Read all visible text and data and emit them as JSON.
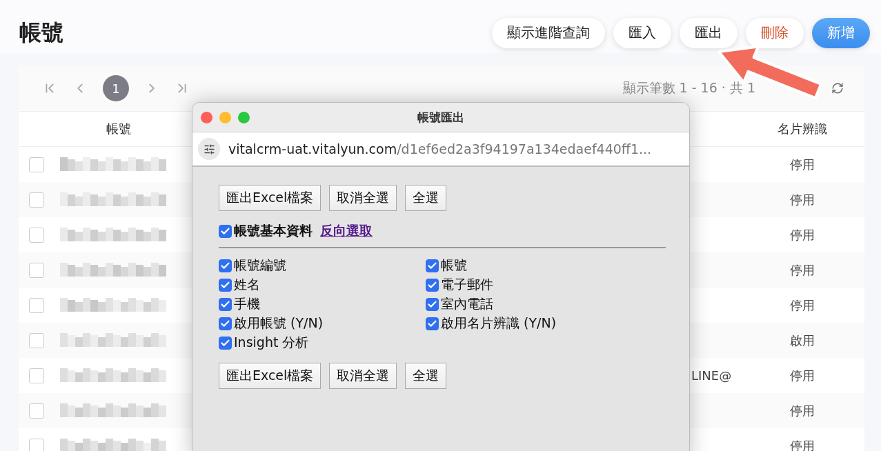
{
  "page": {
    "title": "帳號"
  },
  "actions": [
    {
      "label": "顯示進階查詢",
      "kind": "default"
    },
    {
      "label": "匯入",
      "kind": "default"
    },
    {
      "label": "匯出",
      "kind": "default"
    },
    {
      "label": "刪除",
      "kind": "danger"
    },
    {
      "label": "新增",
      "kind": "primary"
    }
  ],
  "pagination": {
    "pages": [
      {
        "label": "1",
        "selected": true
      }
    ],
    "summary": "顯示筆數 1 - 16 · 共 1"
  },
  "table": {
    "columns": [
      "帳號",
      "名片辨識"
    ],
    "rows": [
      {
        "checked": false,
        "card_recognition": "停用"
      },
      {
        "checked": false,
        "card_recognition": "停用"
      },
      {
        "checked": false,
        "card_recognition": "停用"
      },
      {
        "checked": false,
        "card_recognition": "停用"
      },
      {
        "checked": false,
        "card_recognition": "停用"
      },
      {
        "checked": false,
        "card_recognition": "啟用"
      },
      {
        "checked": false,
        "column_3": "LINE@",
        "card_recognition": "停用"
      },
      {
        "checked": false,
        "card_recognition": "停用"
      },
      {
        "checked": false,
        "card_recognition": "停用"
      }
    ]
  },
  "dialog": {
    "title": "帳號匯出",
    "url_host": "vitalcrm-uat.vitalyun.com",
    "url_path": "/d1ef6ed2a3f94197a134edaef440ff1...",
    "buttons_top": [
      "匯出Excel檔案",
      "取消全選",
      "全選"
    ],
    "group": {
      "label": "帳號基本資料",
      "checked": true,
      "link": "反向選取"
    },
    "fields": [
      {
        "label": "帳號編號",
        "checked": true
      },
      {
        "label": "帳號",
        "checked": true
      },
      {
        "label": "姓名",
        "checked": true
      },
      {
        "label": "電子郵件",
        "checked": true
      },
      {
        "label": "手機",
        "checked": true
      },
      {
        "label": "室內電話",
        "checked": true
      },
      {
        "label": "啟用帳號 (Y/N)",
        "checked": true
      },
      {
        "label": "啟用名片辨識 (Y/N)",
        "checked": true
      },
      {
        "label": "Insight 分析",
        "checked": true
      }
    ],
    "buttons_bottom": [
      "匯出Excel檔案",
      "取消全選",
      "全選"
    ]
  }
}
